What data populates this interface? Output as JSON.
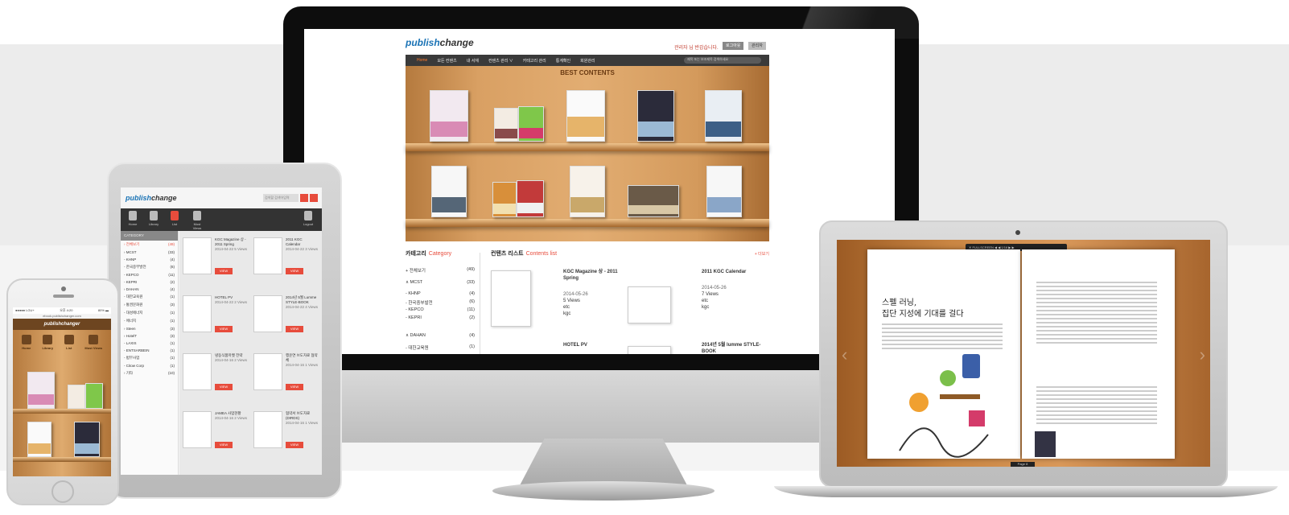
{
  "monitor": {
    "logo_bold": "publish",
    "logo_rest": "change",
    "greeting": "관리자 님 반갑습니다.",
    "top_buttons": [
      "로그아웃",
      "관리자"
    ],
    "nav": [
      "Home",
      "모든 컨텐츠",
      "내 서재",
      "컨텐츠 관리 ∨",
      "카테고리 관리",
      "통계확인",
      "회원관리"
    ],
    "search_placeholder": "제목 또는 보조제목 검색하세요",
    "shelf_title": "BEST CONTENTS",
    "category": {
      "title": "카테고리",
      "title_en": "Category",
      "rows": [
        {
          "label": "+ 전체보기",
          "count": "(49)"
        },
        {
          "label": "∧ MCST",
          "count": "(33)"
        },
        {
          "label": "- KHNP",
          "count": "(4)"
        },
        {
          "label": "- 한국중부발전",
          "count": "(6)"
        },
        {
          "label": "- KEPCO",
          "count": "(11)"
        },
        {
          "label": "- KEPRI",
          "count": "(2)"
        },
        {
          "label": "∧ DAHAN",
          "count": "(4)"
        },
        {
          "label": "- 대한교육원",
          "count": "(1)"
        }
      ]
    },
    "contents": {
      "title": "컨텐츠 리스트",
      "title_en": "Contents list",
      "more": "+ 더보기",
      "items": [
        {
          "title": "KGC Magazine 상 - 2011 Spring",
          "date": "2014-05-26",
          "views": "5 Views",
          "etc": "etc",
          "owner": "kgc"
        },
        {
          "title": "2011 KGC Calendar",
          "date": "2014-05-26",
          "views": "7 Views",
          "etc": "etc",
          "owner": "kgc"
        },
        {
          "title": "HOTEL PV",
          "date": "",
          "views": "",
          "etc": "",
          "owner": ""
        },
        {
          "title": "2014년 5월 lumme STYLE-BOOK",
          "date": "",
          "views": "",
          "etc": "",
          "owner": ""
        }
      ]
    }
  },
  "tablet": {
    "logo_bold": "publish",
    "logo_rest": "change",
    "search_placeholder": "검색할 검색어입력",
    "tools": [
      "Home",
      "Library",
      "List",
      "Most Views",
      "Logout"
    ],
    "category_header": "CATEGORY",
    "rows": [
      {
        "label": "› 전체보기",
        "count": "(49)",
        "red": true
      },
      {
        "label": "› MCST",
        "count": "(33)"
      },
      {
        "label": "- KHNP",
        "count": "(4)"
      },
      {
        "label": "- 한국중부발전",
        "count": "(6)"
      },
      {
        "label": "- KEPCO",
        "count": "(11)"
      },
      {
        "label": "- KEPRI",
        "count": "(2)"
      },
      {
        "label": "› DAHAN",
        "count": "(4)"
      },
      {
        "label": "- 대한교육원",
        "count": "(1)"
      },
      {
        "label": "› 통권문화원",
        "count": "(3)"
      },
      {
        "label": "- 대성에너지",
        "count": "(1)"
      },
      {
        "label": "- 에너지",
        "count": "(1)"
      },
      {
        "label": "› Steen",
        "count": "(3)"
      },
      {
        "label": "› HotelT",
        "count": "(3)"
      },
      {
        "label": "- LAXIS",
        "count": "(1)"
      },
      {
        "label": "- ENTSARBEIN",
        "count": "(1)"
      },
      {
        "label": "- 법무사업",
        "count": "(1)"
      },
      {
        "label": "- Citow Corp",
        "count": "(1)"
      },
      {
        "label": "› 기타",
        "count": "(10)"
      }
    ],
    "cards": [
      {
        "title": "KGC Magazine 상 - 2011 Spring",
        "meta": "2014-04-22 5 Views"
      },
      {
        "title": "2011 KGC Calendar",
        "meta": "2014-04-22 3 Views"
      },
      {
        "title": "HOTEL PV",
        "meta": "2014-04-22 2 Views"
      },
      {
        "title": "2014년 5월 Lumme STYLE-BOOK",
        "meta": "2014-04-22 4 Views"
      },
      {
        "title": "냉동식품마켓 전략",
        "meta": "2014-04-16 2 Views"
      },
      {
        "title": "행운연 브도자료 협약 체",
        "meta": "2014-04-16 1 Views"
      },
      {
        "title": "JAMEA 사업현황",
        "meta": "2014-04-16 2 Views"
      },
      {
        "title": "협약서 브도자료 (DIRDS)",
        "meta": "2014-04-16 1 Views"
      }
    ],
    "view_label": "VIEW"
  },
  "phone": {
    "status_left": "●●●●● LGU+",
    "status_center": "오후 4:20",
    "status_right": "80% ▬",
    "url": "ebook.publishchanger.com",
    "header": "publishchanger",
    "icons": [
      "Home",
      "Library",
      "List",
      "Most Views"
    ]
  },
  "laptop": {
    "toolbar": "✕ FULLSCREEN  ◀ ◀  1/16  ▶ ▶",
    "title_line1": "스펠 러닝,",
    "title_line2": "집단 지성에 기대를 걸다",
    "bottom": "Page 8"
  },
  "colors": {
    "accent": "#e74c3c",
    "brand_blue": "#1a73b5",
    "nav_active": "#ff7a2b",
    "wood": "#d9a063"
  }
}
